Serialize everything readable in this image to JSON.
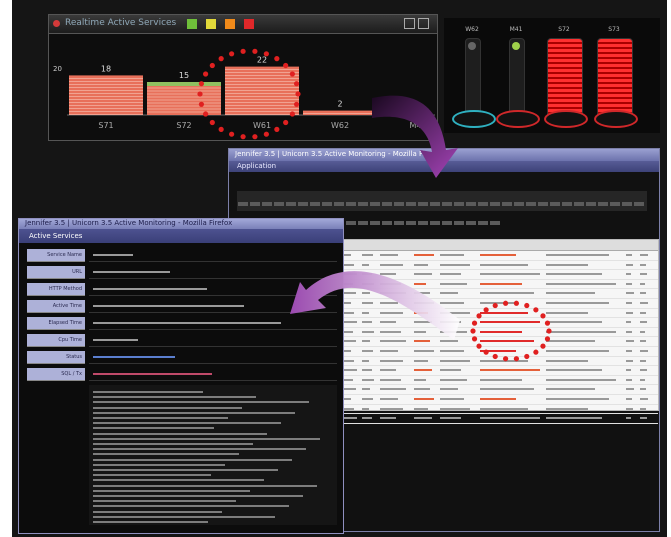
{
  "panel1": {
    "title": "Realtime Active Services",
    "chart_data": {
      "type": "bar",
      "title": "Realtime Active Services",
      "categories": [
        "S71",
        "S72",
        "W61",
        "W62",
        "M41"
      ],
      "values": [
        18,
        15,
        22,
        2,
        0
      ],
      "value_labels": [
        "18",
        "15",
        "22",
        "2",
        ""
      ],
      "ylim": [
        0,
        30
      ],
      "xlabel": "",
      "ylabel": "",
      "bar_colors": [
        "#e8705a",
        "#e8705a",
        "#e8705a",
        "#e8705a",
        "#e8705a"
      ],
      "highlight_color": "#8fc060"
    },
    "y_marker": "20",
    "legend_colors": [
      "#6fbf3a",
      "#e2d93a",
      "#f08a1a",
      "#e0282a"
    ]
  },
  "panel2": {
    "gauges": [
      {
        "label": "W62",
        "color": "#222",
        "ring": "#2fb0c0",
        "fill": 0.05
      },
      {
        "label": "M41",
        "color": "#222",
        "ring": "#d0282a",
        "fill": 0.1
      },
      {
        "label": "S72",
        "color": "#e02020",
        "ring": "#d0282a",
        "fill": 0.9
      },
      {
        "label": "S73",
        "color": "#e02020",
        "ring": "#d0282a",
        "fill": 1.0
      }
    ]
  },
  "panel3": {
    "title": "Jennifer 3.5 | Unicorn 3.5 Active Monitoring - Mozilla Firefox",
    "subtitle": "Application"
  },
  "panel4": {
    "title": "Jennifer 3.5 | Unicorn 3.5 Active Monitoring - Mozilla Firefox",
    "subtitle": "Active Services",
    "fields": [
      {
        "label": "Service Name"
      },
      {
        "label": "URL"
      },
      {
        "label": "HTTP Method"
      },
      {
        "label": "Active Time"
      },
      {
        "label": "Elapsed Time"
      },
      {
        "label": "Cpu Time"
      },
      {
        "label": "Status"
      },
      {
        "label": "SQL / Tx"
      }
    ]
  },
  "colors": {
    "accent": "#7c7fa8",
    "highlight": "#e02020",
    "arrow": "#8b3fa0"
  }
}
